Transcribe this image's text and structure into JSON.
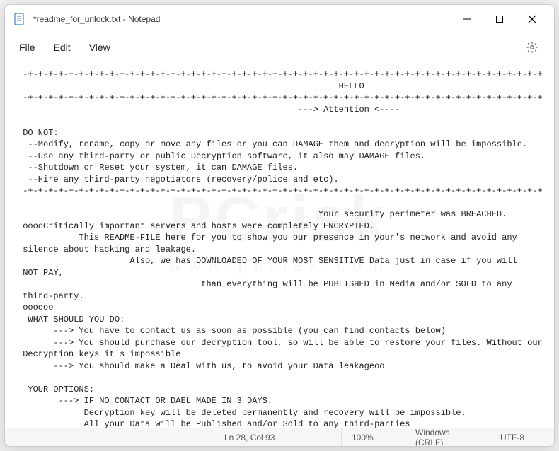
{
  "window": {
    "title": "*readme_for_unlock.txt - Notepad"
  },
  "menu": {
    "file": "File",
    "edit": "Edit",
    "view": "View"
  },
  "watermark": {
    "main": "PCrisk",
    "sub": "www.pcrisk.com"
  },
  "document": {
    "text": " -+-+-+-+-+-+-+-+-+-+-+-+-+-+-+-+-+-+-+-+-+-+-+-+-+-+-+-+-+-+-+-+-+-+-+-+-+-+-+-+-+-+-+-+-+-+-+-+-+-+-+\n                                                               HELLO\n -+-+-+-+-+-+-+-+-+-+-+-+-+-+-+-+-+-+-+-+-+-+-+-+-+-+-+-+-+-+-+-+-+-+-+-+-+-+-+-+-+-+-+-+-+-+-+-+-+-+-+\n                                                       ---> Attention <----\n\n DO NOT:\n  --Modify, rename, copy or move any files or you can DAMAGE them and decryption will be impossible.\n  --Use any third-party or public Decryption software, it also may DAMAGE files.\n  --Shutdown or Reset your system, it can DAMAGE files.\n  --Hire any third-party negotiators (recovery/police and etc).\n -+-+-+-+-+-+-+-+-+-+-+-+-+-+-+-+-+-+-+-+-+-+-+-+-+-+-+-+-+-+-+-+-+-+-+-+-+-+-+-+-+-+-+-+-+-+-+-+-+-+-+\n\n                                                           Your security perimeter was BREACHED.\n ooooCritically important servers and hosts were completely ENCRYPTED.\n            This README-FILE here for you to show you our presence in your's network and avoid any\n silence about hacking and leakage.\n                      Also, we has DOWNLOADED OF YOUR MOST SENSITIVE Data just in case if you will\n NOT PAY,\n                                    than everything will be PUBLISHED in Media and/or SOLD to any\n third-party.\n oooooo\n  WHAT SHOULD YOU DO:\n       ---> You have to contact us as soon as possible (you can find contacts below)\n       ---> You should purchase our decryption tool, so will be able to restore your files. Without our\n Decryption keys it's impossible\n       ---> You should make a Deal with us, to avoid your Data leakageoo\n\n  YOUR OPTIONS:\n        ---> IF NO CONTACT OR DAEL MADE IN 3 DAYS:\n             Decryption key will be deleted permanently and recovery will be impossible.\n             All your Data will be Published and/or Sold to any third-parties\n             Information regarding vulnerabilities of your network also can be published and/or shared"
  },
  "statusbar": {
    "position": "Ln 28, Col 93",
    "zoom": "100%",
    "line_ending": "Windows (CRLF)",
    "encoding": "UTF-8"
  }
}
